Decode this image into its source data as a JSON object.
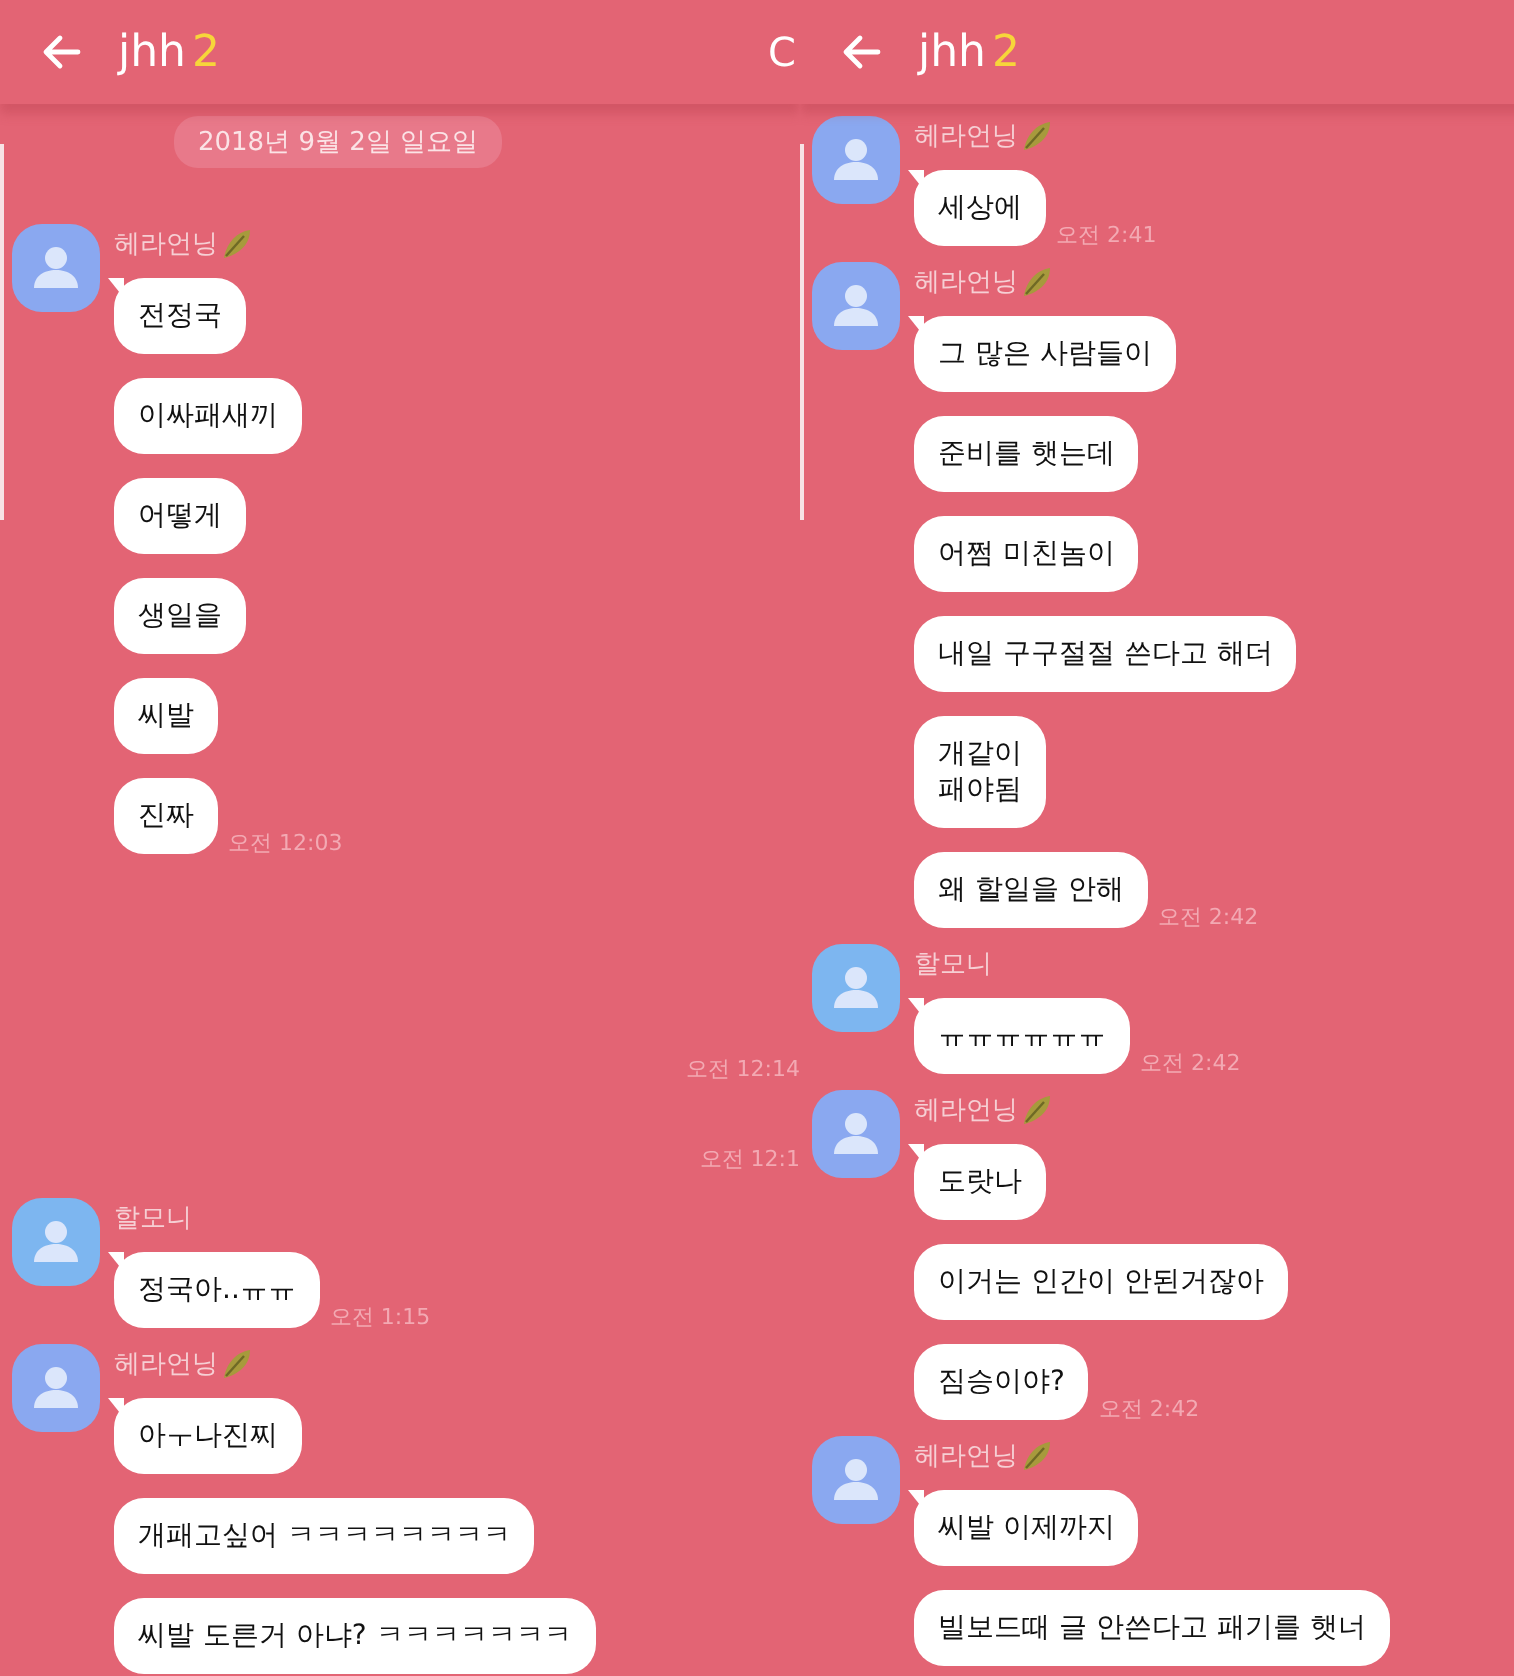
{
  "panels": [
    {
      "header": {
        "title": "jhh",
        "badge": "2",
        "edge_text": "C"
      },
      "items": [
        {
          "kind": "date",
          "text": "2018년 9월 2일 일요일"
        },
        {
          "kind": "group",
          "sender": "헤라언닝",
          "leaf": true,
          "color": "#8aa8f0",
          "messages": [
            "전정국",
            "이싸패새끼",
            "어떻게",
            "생일을",
            "씨발",
            "진짜"
          ],
          "time": "오전 12:03"
        },
        {
          "kind": "time",
          "text": "오전 12:14"
        },
        {
          "kind": "time",
          "text": "오전 12:1"
        },
        {
          "kind": "group",
          "sender": "할모니",
          "leaf": false,
          "color": "#7db6f0",
          "messages": [
            "정국아..ㅠㅠ"
          ],
          "time": "오전 1:15"
        },
        {
          "kind": "group",
          "sender": "헤라언닝",
          "leaf": true,
          "color": "#8aa8f0",
          "messages": [
            "아ㅜ나진찌",
            "개패고싶어 ㅋㅋㅋㅋㅋㅋㅋㅋ",
            "씨발 도른거 아냐? ㅋㅋㅋㅋㅋㅋㅋ"
          ]
        }
      ]
    },
    {
      "header": {
        "title": "jhh",
        "badge": "2"
      },
      "items": [
        {
          "kind": "group",
          "sender": "헤라언닝",
          "leaf": true,
          "color": "#8aa8f0",
          "messages": [
            "세상에"
          ],
          "time": "오전 2:41"
        },
        {
          "kind": "group",
          "sender": "헤라언닝",
          "leaf": true,
          "color": "#8aa8f0",
          "messages": [
            "그 많은 사람들이",
            "준비를 햇는데",
            "어쩜 미친놈이",
            "내일 구구절절 쓴다고 해더",
            "개같이\n패야됨",
            "왜 할일을 안해"
          ],
          "time": "오전 2:42"
        },
        {
          "kind": "group",
          "sender": "할모니",
          "leaf": false,
          "color": "#7db6f0",
          "messages": [
            "ㅠㅠㅠㅠㅠㅠ"
          ],
          "time": "오전 2:42"
        },
        {
          "kind": "group",
          "sender": "헤라언닝",
          "leaf": true,
          "color": "#8aa8f0",
          "messages": [
            "도랏나",
            "이거는 인간이 안된거잖아",
            "짐승이야?"
          ],
          "time": "오전 2:42"
        },
        {
          "kind": "group",
          "sender": "헤라언닝",
          "leaf": true,
          "color": "#8aa8f0",
          "messages": [
            "씨발 이제까지",
            "빌보드때 글 안쓴다고 패기를 햇너"
          ]
        }
      ]
    }
  ]
}
